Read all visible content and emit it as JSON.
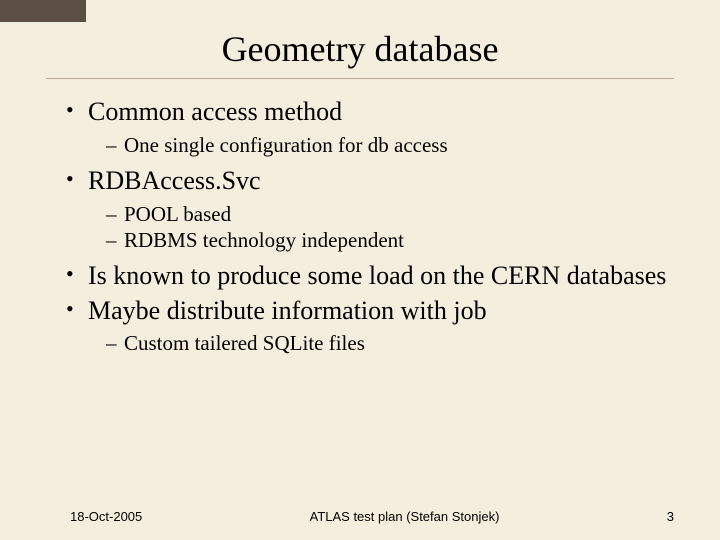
{
  "title": "Geometry database",
  "bullets": [
    {
      "text": "Common access method",
      "sub": [
        {
          "text": "One single configuration for db access"
        }
      ]
    },
    {
      "text": "RDBAccess.Svc",
      "sub": [
        {
          "text": "POOL based"
        },
        {
          "text": "RDBMS technology independent"
        }
      ]
    },
    {
      "text": "Is known to produce some load on the CERN databases",
      "sub": []
    },
    {
      "text": "Maybe distribute information with job",
      "sub": [
        {
          "text": "Custom tailered SQLite files"
        }
      ]
    }
  ],
  "footer": {
    "date": "18-Oct-2005",
    "center": "ATLAS test plan (Stefan Stonjek)",
    "page": "3"
  }
}
